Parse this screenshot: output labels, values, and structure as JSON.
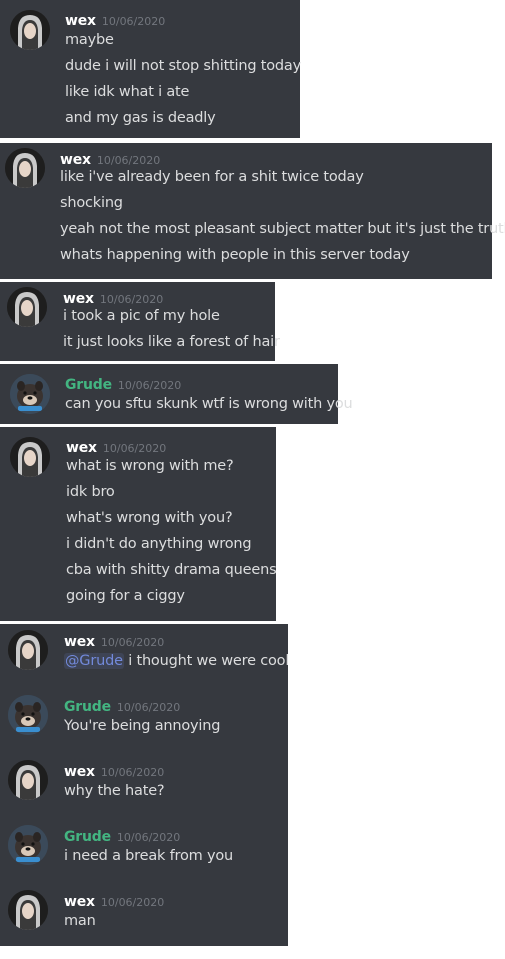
{
  "panels": [
    {
      "username": "wex",
      "timestamp": "10/06/2020",
      "lines": [
        "maybe",
        "dude i will not stop shitting today",
        "like idk what i ate",
        "and my gas is deadly"
      ]
    },
    {
      "username": "wex",
      "timestamp": "10/06/2020",
      "lines": [
        "like i've already been for a shit twice today",
        "shocking",
        "yeah not the most pleasant subject matter but it's just the truth",
        "whats happening with people in this server today"
      ]
    },
    {
      "username": "wex",
      "timestamp": "10/06/2020",
      "lines": [
        "i took a pic of my hole",
        "it just looks like a forest of hair"
      ]
    },
    {
      "username": "Grude",
      "timestamp": "10/06/2020",
      "lines": [
        "can you sftu skunk wtf is wrong with you"
      ]
    },
    {
      "username": "wex",
      "timestamp": "10/06/2020",
      "lines": [
        "what is wrong with me?",
        "idk bro",
        "what's wrong with you?",
        "i didn't do anything wrong",
        "cba with shitty drama queens",
        "going for a ciggy"
      ]
    }
  ],
  "conversation": [
    {
      "username": "wex",
      "timestamp": "10/06/2020",
      "mention": "@Grude",
      "text": " i thought we were cool"
    },
    {
      "username": "Grude",
      "timestamp": "10/06/2020",
      "text": "You're being annoying"
    },
    {
      "username": "wex",
      "timestamp": "10/06/2020",
      "text": "why the hate?"
    },
    {
      "username": "Grude",
      "timestamp": "10/06/2020",
      "text": "i need a break from you"
    },
    {
      "username": "wex",
      "timestamp": "10/06/2020",
      "text": "man"
    }
  ],
  "colors": {
    "background": "#36393f",
    "text": "#dcddde",
    "timestamp": "#72767d",
    "grude": "#43b581",
    "mention": "#7289da"
  }
}
